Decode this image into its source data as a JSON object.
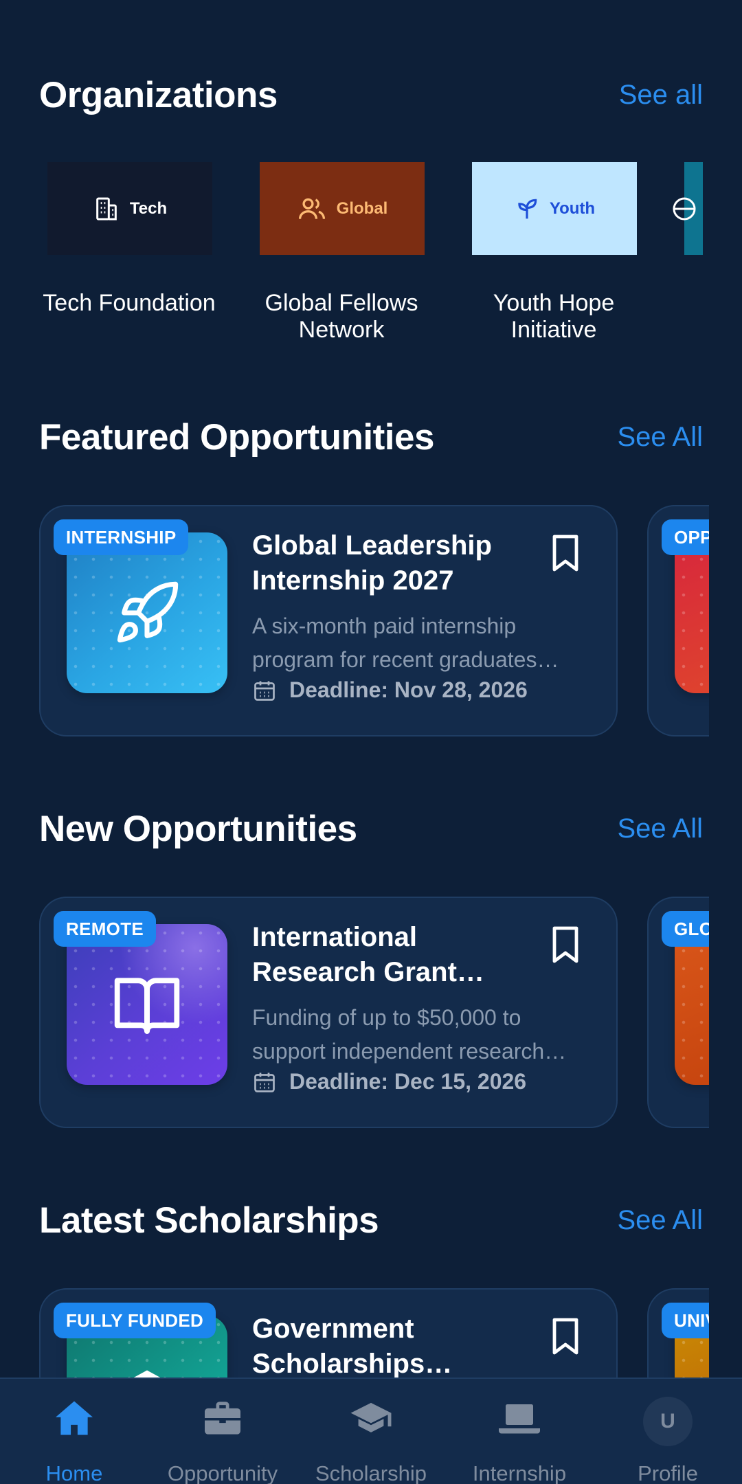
{
  "organizations": {
    "title": "Organizations",
    "see_all": "See all",
    "items": [
      {
        "logo_text": "Tech",
        "name": "Tech Foundation",
        "icon": "building-icon",
        "bg": "#111a2e",
        "fg": "#ffffff"
      },
      {
        "logo_text": "Global",
        "name": "Global Fellows Network",
        "icon": "users-icon",
        "bg": "#7c2d12",
        "fg": "#fdba74"
      },
      {
        "logo_text": "Youth",
        "name": "Youth Hope Initiative",
        "icon": "sprout-icon",
        "bg": "#bfe6ff",
        "fg": "#1d4ed8"
      },
      {
        "logo_text": "",
        "name": "",
        "icon": "globe-icon",
        "bg": "#0e7490",
        "fg": "#ffffff"
      }
    ]
  },
  "featured": {
    "title": "Featured Opportunities",
    "see_all": "See All",
    "card": {
      "badge": "INTERNSHIP",
      "title": "Global Leadership Internship 2027",
      "description": "A six-month paid internship program for recent graduates…",
      "deadline": "Deadline: Nov 28, 2026",
      "icon": "rocket-icon"
    },
    "peek_badge": "OPPORTUNITY"
  },
  "new_opportunities": {
    "title": "New Opportunities",
    "see_all": "See All",
    "card": {
      "badge": "REMOTE",
      "title": "International Research Grant…",
      "description": "Funding of up to $50,000 to support independent research…",
      "deadline": "Deadline: Dec 15, 2026",
      "icon": "book-open-icon"
    },
    "peek_badge": "GLOBAL"
  },
  "scholarships": {
    "title": "Latest Scholarships",
    "see_all": "See All",
    "card": {
      "badge": "FULLY FUNDED",
      "title": "Government Scholarships…",
      "icon": "graduation-cap-icon"
    },
    "peek_badge": "UNIVERSITY"
  },
  "nav": {
    "items": [
      {
        "label": "Home",
        "icon": "home-icon",
        "active": true
      },
      {
        "label": "Opportunity",
        "icon": "briefcase-icon",
        "active": false
      },
      {
        "label": "Scholarship",
        "icon": "graduation-cap-icon",
        "active": false
      },
      {
        "label": "Internship",
        "icon": "laptop-icon",
        "active": false
      },
      {
        "label": "Profile",
        "icon": "avatar",
        "active": false
      }
    ],
    "avatar_initial": "U"
  },
  "colors": {
    "background": "#0d1f38",
    "card": "#132b4b",
    "accent": "#2b8ef0",
    "badge": "#1c86ee"
  }
}
